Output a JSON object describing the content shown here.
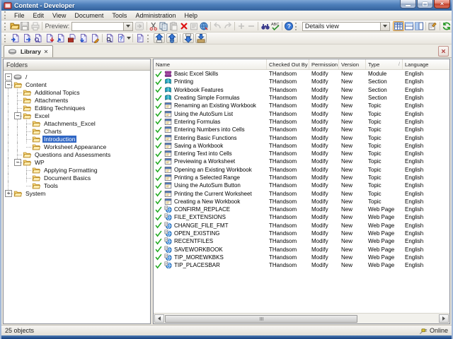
{
  "window": {
    "title": "Content - Developer"
  },
  "menu": {
    "items": [
      "File",
      "Edit",
      "View",
      "Document",
      "Tools",
      "Administration",
      "Help"
    ]
  },
  "toolbar_main": {
    "items": [
      {
        "kind": "grip"
      },
      {
        "kind": "icon",
        "name": "open-button",
        "icon": "openFolder"
      },
      {
        "kind": "icon",
        "name": "save-button",
        "icon": "save",
        "disabled": true
      },
      {
        "kind": "icon",
        "name": "print-button",
        "icon": "print",
        "disabled": true
      },
      {
        "kind": "sep"
      },
      {
        "kind": "label",
        "name": "preview-label",
        "text": "Preview:"
      },
      {
        "kind": "combo",
        "name": "preview-combo",
        "value": ""
      },
      {
        "kind": "icon",
        "name": "preview-go-button",
        "icon": "go",
        "disabled": true
      },
      {
        "kind": "sep"
      },
      {
        "kind": "icon",
        "name": "cut-button",
        "icon": "cut"
      },
      {
        "kind": "icon",
        "name": "copy-button",
        "icon": "copy"
      },
      {
        "kind": "icon",
        "name": "paste-button",
        "icon": "paste",
        "disabled": true
      },
      {
        "kind": "icon",
        "name": "delete-button",
        "icon": "del"
      },
      {
        "kind": "icon",
        "name": "paste-special-button",
        "icon": "pasteSp",
        "disabled": true
      },
      {
        "kind": "icon",
        "name": "replace-button",
        "icon": "webRepl"
      },
      {
        "kind": "sep"
      },
      {
        "kind": "icon",
        "name": "undo-button",
        "icon": "undo",
        "disabled": true
      },
      {
        "kind": "icon",
        "name": "redo-button",
        "icon": "redo",
        "disabled": true
      },
      {
        "kind": "sep"
      },
      {
        "kind": "icon",
        "name": "zoom-in-button",
        "icon": "plus",
        "disabled": true
      },
      {
        "kind": "icon",
        "name": "zoom-out-button",
        "icon": "minus",
        "disabled": true
      },
      {
        "kind": "sep"
      },
      {
        "kind": "icon",
        "name": "find-button",
        "icon": "find"
      },
      {
        "kind": "icon",
        "name": "spellcheck-button",
        "icon": "abc"
      },
      {
        "kind": "sep"
      },
      {
        "kind": "icon",
        "name": "help-button",
        "icon": "help"
      },
      {
        "kind": "grip"
      },
      {
        "kind": "combo",
        "name": "view-combo",
        "value": "Details view"
      },
      {
        "kind": "icon",
        "name": "details-view-button",
        "icon": "detailsView",
        "active": true
      },
      {
        "kind": "icon",
        "name": "split-horizontal-button",
        "icon": "splitH"
      },
      {
        "kind": "icon",
        "name": "split-vertical-button",
        "icon": "splitV"
      },
      {
        "kind": "sep"
      },
      {
        "kind": "icon",
        "name": "properties-button",
        "icon": "props"
      },
      {
        "kind": "sep"
      },
      {
        "kind": "icon",
        "name": "refresh-button",
        "icon": "refresh"
      }
    ]
  },
  "toolbar_document": {
    "items": [
      {
        "kind": "grip"
      },
      {
        "kind": "icon",
        "name": "import-content-button",
        "icon": "docIn"
      },
      {
        "kind": "icon",
        "name": "export-content-button",
        "icon": "docOut"
      },
      {
        "kind": "icon",
        "name": "search-content-button",
        "icon": "docFind"
      },
      {
        "kind": "icon",
        "name": "checkout-content-button",
        "icon": "docRed"
      },
      {
        "kind": "icon",
        "name": "share-content-button",
        "icon": "docBlue"
      },
      {
        "kind": "icon",
        "name": "package-content-button",
        "icon": "docPkg"
      },
      {
        "kind": "icon",
        "name": "download-content-button",
        "icon": "docDown"
      },
      {
        "kind": "icon",
        "name": "edit-content-button",
        "icon": "docEdit"
      },
      {
        "kind": "sep"
      },
      {
        "kind": "icon",
        "name": "search-help-button",
        "icon": "docSearch"
      },
      {
        "kind": "icon",
        "name": "help-topics-dropdown",
        "icon": "docQ",
        "dropdown": true
      },
      {
        "kind": "sep"
      },
      {
        "kind": "icon",
        "name": "preview-content-button",
        "icon": "docPrev"
      },
      {
        "kind": "grip"
      },
      {
        "kind": "icon",
        "name": "check-in-button",
        "icon": "upPage",
        "raised": true
      },
      {
        "kind": "icon",
        "name": "publish-button",
        "icon": "upGlobe",
        "raised": true
      },
      {
        "kind": "sep"
      },
      {
        "kind": "icon",
        "name": "check-out-button",
        "icon": "downPage",
        "raised": true
      },
      {
        "kind": "icon",
        "name": "get-latest-button",
        "icon": "downBox",
        "raised": true
      }
    ]
  },
  "tabs": {
    "label": "Library"
  },
  "folders_panel": {
    "header": "Folders",
    "tree": [
      {
        "label": "/",
        "level": 0,
        "icon": "repository",
        "expander": "minus"
      },
      {
        "label": "Content",
        "level": 1,
        "icon": "folder",
        "expander": "minus"
      },
      {
        "label": "Additional Topics",
        "level": 2,
        "icon": "folder",
        "expander": null
      },
      {
        "label": "Attachments",
        "level": 2,
        "icon": "folder",
        "expander": null
      },
      {
        "label": "Editing Techniques",
        "level": 2,
        "icon": "folder",
        "expander": null
      },
      {
        "label": "Excel",
        "level": 2,
        "icon": "folder",
        "expander": "minus"
      },
      {
        "label": "Attachments_Excel",
        "level": 3,
        "icon": "folder",
        "expander": null
      },
      {
        "label": "Charts",
        "level": 3,
        "icon": "folder",
        "expander": null
      },
      {
        "label": "Introduction",
        "level": 3,
        "icon": "folder",
        "expander": null,
        "selected": true
      },
      {
        "label": "Worksheet Appearance",
        "level": 3,
        "icon": "folder",
        "expander": null
      },
      {
        "label": "Questions and Assessments",
        "level": 2,
        "icon": "folder",
        "expander": null
      },
      {
        "label": "WP",
        "level": 2,
        "icon": "folder",
        "expander": "minus"
      },
      {
        "label": "Applying Formatting",
        "level": 3,
        "icon": "folder",
        "expander": null
      },
      {
        "label": "Document Basics",
        "level": 3,
        "icon": "folder",
        "expander": null
      },
      {
        "label": "Tools",
        "level": 3,
        "icon": "folder",
        "expander": null
      },
      {
        "label": "System",
        "level": 1,
        "icon": "folder",
        "expander": "plus"
      }
    ]
  },
  "list": {
    "columns": [
      {
        "label": "Name"
      },
      {
        "label": "Checked Out By"
      },
      {
        "label": "Permission"
      },
      {
        "label": "Version"
      },
      {
        "label": "Type",
        "sort_indicator": "/"
      },
      {
        "label": "Language"
      }
    ],
    "rows": [
      {
        "name": "Basic Excel Skills",
        "checked_out_by": "THandsom",
        "permission": "Modify",
        "version": "New",
        "type": "Module",
        "language": "English"
      },
      {
        "name": "Printing",
        "checked_out_by": "THandsom",
        "permission": "Modify",
        "version": "New",
        "type": "Section",
        "language": "English"
      },
      {
        "name": "Workbook Features",
        "checked_out_by": "THandsom",
        "permission": "Modify",
        "version": "New",
        "type": "Section",
        "language": "English"
      },
      {
        "name": "Creating Simple Formulas",
        "checked_out_by": "THandsom",
        "permission": "Modify",
        "version": "New",
        "type": "Section",
        "language": "English"
      },
      {
        "name": "Renaming an Existing Workbook",
        "checked_out_by": "THandsom",
        "permission": "Modify",
        "version": "New",
        "type": "Topic",
        "language": "English"
      },
      {
        "name": "Using the AutoSum List",
        "checked_out_by": "THandsom",
        "permission": "Modify",
        "version": "New",
        "type": "Topic",
        "language": "English"
      },
      {
        "name": "Entering Formulas",
        "checked_out_by": "THandsom",
        "permission": "Modify",
        "version": "New",
        "type": "Topic",
        "language": "English"
      },
      {
        "name": "Entering Numbers into Cells",
        "checked_out_by": "THandsom",
        "permission": "Modify",
        "version": "New",
        "type": "Topic",
        "language": "English"
      },
      {
        "name": "Entering Basic Functions",
        "checked_out_by": "THandsom",
        "permission": "Modify",
        "version": "New",
        "type": "Topic",
        "language": "English"
      },
      {
        "name": "Saving a Workbook",
        "checked_out_by": "THandsom",
        "permission": "Modify",
        "version": "New",
        "type": "Topic",
        "language": "English"
      },
      {
        "name": "Entering Text into Cells",
        "checked_out_by": "THandsom",
        "permission": "Modify",
        "version": "New",
        "type": "Topic",
        "language": "English"
      },
      {
        "name": "Previewing a Worksheet",
        "checked_out_by": "THandsom",
        "permission": "Modify",
        "version": "New",
        "type": "Topic",
        "language": "English"
      },
      {
        "name": "Opening an Existing Workbook",
        "checked_out_by": "THandsom",
        "permission": "Modify",
        "version": "New",
        "type": "Topic",
        "language": "English"
      },
      {
        "name": "Printing a Selected Range",
        "checked_out_by": "THandsom",
        "permission": "Modify",
        "version": "New",
        "type": "Topic",
        "language": "English"
      },
      {
        "name": "Using the AutoSum Button",
        "checked_out_by": "THandsom",
        "permission": "Modify",
        "version": "New",
        "type": "Topic",
        "language": "English"
      },
      {
        "name": "Printing the Current Worksheet",
        "checked_out_by": "THandsom",
        "permission": "Modify",
        "version": "New",
        "type": "Topic",
        "language": "English"
      },
      {
        "name": "Creating a New Workbook",
        "checked_out_by": "THandsom",
        "permission": "Modify",
        "version": "New",
        "type": "Topic",
        "language": "English"
      },
      {
        "name": "CONFIRM_REPLACE",
        "checked_out_by": "THandsom",
        "permission": "Modify",
        "version": "New",
        "type": "Web Page",
        "language": "English"
      },
      {
        "name": "FILE_EXTENSIONS",
        "checked_out_by": "THandsom",
        "permission": "Modify",
        "version": "New",
        "type": "Web Page",
        "language": "English"
      },
      {
        "name": "CHANGE_FILE_FMT",
        "checked_out_by": "THandsom",
        "permission": "Modify",
        "version": "New",
        "type": "Web Page",
        "language": "English"
      },
      {
        "name": "OPEN_EXISTING",
        "checked_out_by": "THandsom",
        "permission": "Modify",
        "version": "New",
        "type": "Web Page",
        "language": "English"
      },
      {
        "name": "RECENTFILES",
        "checked_out_by": "THandsom",
        "permission": "Modify",
        "version": "New",
        "type": "Web Page",
        "language": "English"
      },
      {
        "name": "SAVEWORKBOOK",
        "checked_out_by": "THandsom",
        "permission": "Modify",
        "version": "New",
        "type": "Web Page",
        "language": "English"
      },
      {
        "name": "TIP_MOREWKBKS",
        "checked_out_by": "THandsom",
        "permission": "Modify",
        "version": "New",
        "type": "Web Page",
        "language": "English"
      },
      {
        "name": "TIP_PLACESBAR",
        "checked_out_by": "THandsom",
        "permission": "Modify",
        "version": "New",
        "type": "Web Page",
        "language": "English"
      }
    ]
  },
  "status": {
    "left": "25 objects",
    "right": "Online"
  },
  "colors": {
    "selection": "#2f66c4",
    "active_tool_border": "#d89a3e",
    "title_gradient_top": "#7fa7d6",
    "title_gradient_bottom": "#35629c",
    "check_green": "#22aa22"
  }
}
